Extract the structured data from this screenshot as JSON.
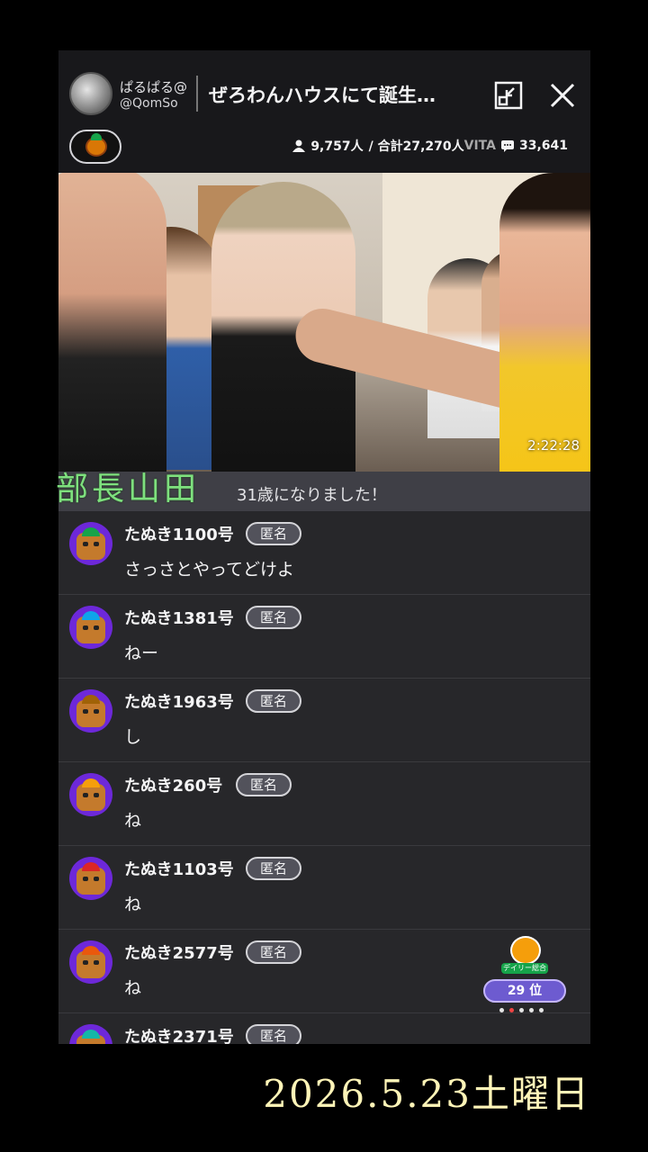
{
  "header": {
    "channel_name": "ぱるぱる@",
    "channel_handle": "@QomSo",
    "title": "ぜろわんハウスにて誕生…",
    "stats": {
      "viewers": "9,757人",
      "total": "/ 合計27,270人",
      "watermark": "VITA",
      "comments": "33,641"
    }
  },
  "video": {
    "timer": "2:22:28"
  },
  "caption": {
    "text": "31歳になりました！"
  },
  "comments": [
    {
      "name": "たぬき1100号",
      "badge": "匿名",
      "message": "さっさとやってどけよ",
      "hat_color": "#16a34a"
    },
    {
      "name": "たぬき1381号",
      "badge": "匿名",
      "message": "ねー",
      "hat_color": "#0ea5e9"
    },
    {
      "name": "たぬき1963号",
      "badge": "匿名",
      "message": "し",
      "hat_color": "#a16207"
    },
    {
      "name": "たぬき260号",
      "badge": "匿名",
      "message": "ね",
      "hat_color": "#f59e0b"
    },
    {
      "name": "たぬき1103号",
      "badge": "匿名",
      "message": "ね",
      "hat_color": "#dc2626"
    },
    {
      "name": "たぬき2577号",
      "badge": "匿名",
      "message": "ね",
      "hat_color": "#ea580c"
    },
    {
      "name": "たぬき2371号",
      "badge": "匿名",
      "message": "",
      "hat_color": "#14b8a6"
    }
  ],
  "daily_rank": {
    "label": "デイリー総合",
    "rank": "29 位"
  },
  "overlay": {
    "name": "部長山田",
    "date": "2026.5.23土曜日"
  }
}
